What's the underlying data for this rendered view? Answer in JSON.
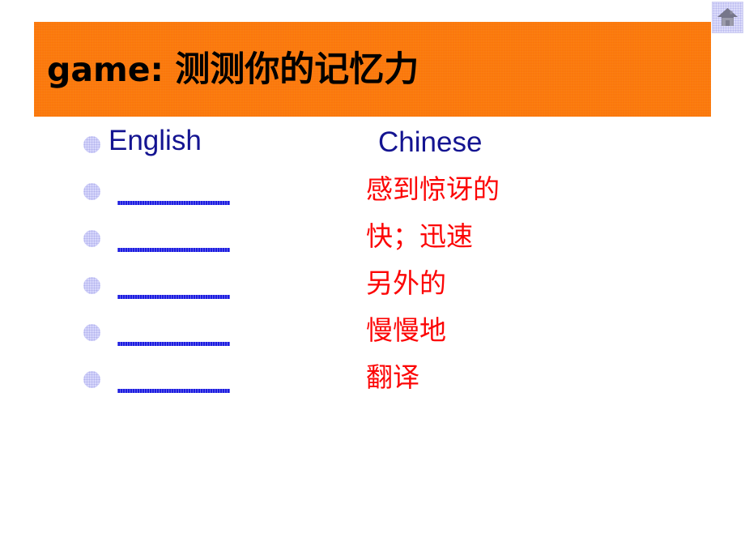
{
  "slide": {
    "background_color": "#ffffff",
    "title": {
      "latin_part": "game:",
      "cjk_part": "测测你的记忆力",
      "full": "game: 测测你的记忆力",
      "banner_color": "#fa7509",
      "text_color": "#000000"
    },
    "home_button": {
      "icon": "home-icon",
      "background_color": "#dcdcfa",
      "icon_color": "#73738c"
    },
    "columns": {
      "english_header": "English",
      "chinese_header": "Chinese",
      "header_color": "#141491",
      "chinese_text_color": "#fc0606",
      "blank_line_color": "#1b1be0",
      "bullet_color": "#d6d6fb"
    },
    "rows": [
      {
        "english": "",
        "chinese": "感到惊讶的"
      },
      {
        "english": "",
        "chinese": "快；迅速"
      },
      {
        "english": "",
        "chinese": "另外的"
      },
      {
        "english": "",
        "chinese": "慢慢地"
      },
      {
        "english": "",
        "chinese": "翻译"
      }
    ]
  }
}
